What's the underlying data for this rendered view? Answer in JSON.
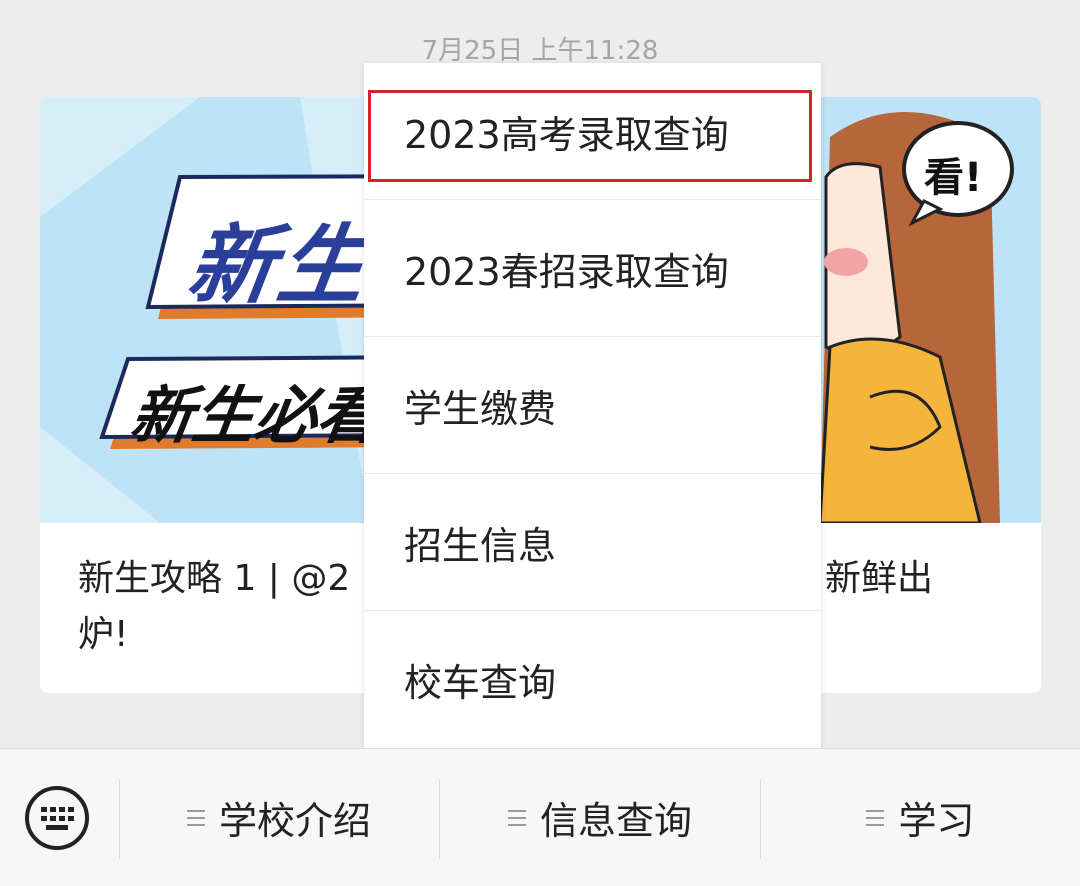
{
  "timestamp": "7月25日 上午11:28",
  "article": {
    "banner_text": "新生",
    "banner_subtext": "新生必看",
    "speech_bubble": "看!",
    "title_line1": "新生攻略 1 | @2",
    "title_line2": "炉!",
    "title_end": "新鲜出"
  },
  "popup_menu": {
    "items": [
      {
        "label": "2023高考录取查询"
      },
      {
        "label": "2023春招录取查询"
      },
      {
        "label": "学生缴费"
      },
      {
        "label": "招生信息"
      },
      {
        "label": "校车查询"
      }
    ],
    "highlighted_index": 0
  },
  "bottom_menu": {
    "keyboard_icon": "keyboard-icon",
    "tabs": [
      {
        "label": "学校介绍",
        "icon": "hamburger-icon"
      },
      {
        "label": "信息查询",
        "icon": "hamburger-icon"
      },
      {
        "label": "学习",
        "icon": "hamburger-icon"
      }
    ]
  },
  "colors": {
    "highlight_border": "#d3242a",
    "cover_background": "#bfe3f6",
    "banner_blue": "#2a3f9a",
    "banner_orange": "#e07a2c",
    "sweater_yellow": "#f5b53b",
    "hair_brown": "#b7653a"
  }
}
